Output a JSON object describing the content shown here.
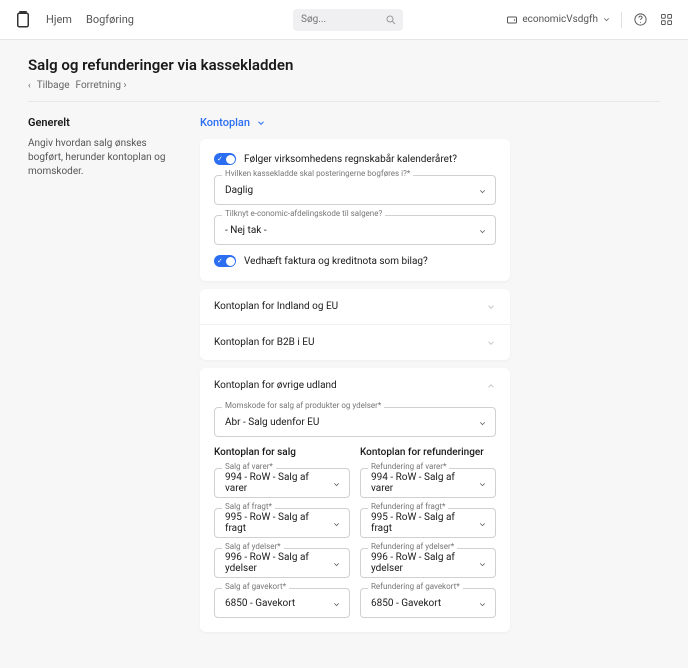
{
  "topbar": {
    "nav": {
      "home": "Hjem",
      "bookkeeping": "Bogføring"
    },
    "search_placeholder": "Søg...",
    "account_name": "economicVsdgfh"
  },
  "page": {
    "title": "Salg og refunderinger via kassekladden",
    "back": "Tilbage",
    "crumb": "Forretning"
  },
  "side": {
    "heading": "Generelt",
    "desc": "Angiv hvordan salg ønskes bogført, herunder kontoplan og momskoder."
  },
  "tab": {
    "label": "Kontoplan"
  },
  "general": {
    "toggle1": "Følger virksomhedens regnskabår kalenderåret?",
    "journal_label": "Hvilken kassekladde skal posteringerne bogføres i?*",
    "journal_value": "Daglig",
    "dept_label": "Tilknyt e-conomic-afdelingskode til salgene?",
    "dept_value": "- Nej tak -",
    "toggle2": "Vedhæft faktura og kreditnota som bilag?"
  },
  "collapsed": {
    "row1": "Kontoplan for Indland og EU",
    "row2": "Kontoplan for B2B i EU"
  },
  "expanded": {
    "title": "Kontoplan for øvrige udland",
    "vat_label": "Momskode for salg af produkter og ydelser*",
    "vat_value": "Abr - Salg udenfor EU",
    "sales_head": "Kontoplan for salg",
    "refund_head": "Kontoplan for refunderinger",
    "sales": {
      "goods_label": "Salg af varer*",
      "goods_value": "994 - RoW - Salg af varer",
      "freight_label": "Salg af fragt*",
      "freight_value": "995 - RoW - Salg af fragt",
      "services_label": "Salg af ydelser*",
      "services_value": "996 - RoW - Salg af ydelser",
      "giftcard_label": "Salg af gavekort*",
      "giftcard_value": "6850 - Gavekort"
    },
    "refund": {
      "goods_label": "Refundering af varer*",
      "goods_value": "994 - RoW - Salg af varer",
      "freight_label": "Refundering af fragt*",
      "freight_value": "995 - RoW - Salg af fragt",
      "services_label": "Refundering af ydelser*",
      "services_value": "996 - RoW - Salg af ydelser",
      "giftcard_label": "Refundering af gavekort*",
      "giftcard_value": "6850 - Gavekort"
    }
  }
}
